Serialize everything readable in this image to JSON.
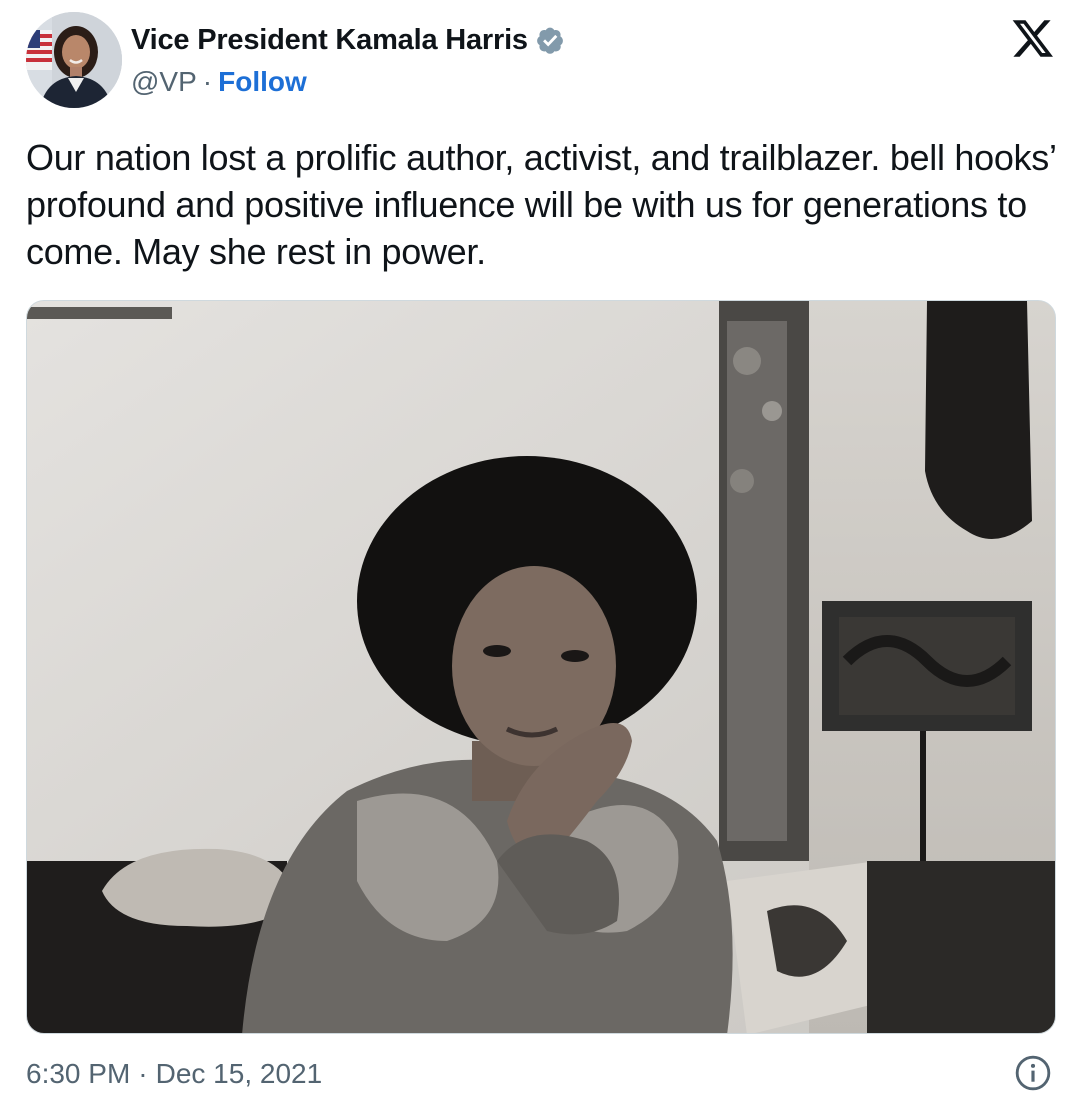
{
  "author": {
    "display_name": "Vice President Kamala Harris",
    "handle": "@VP",
    "separator": "·",
    "follow_label": "Follow",
    "verified_icon": "verified-badge-icon",
    "avatar_alt": "Kamala Harris profile photo"
  },
  "tweet": {
    "text": "Our nation lost a prolific author, activist, and trailblazer. bell hooks’ profound and positive influence will be with us for generations to come. May she rest in power.",
    "media_alt": "Black and white photograph of bell hooks"
  },
  "meta": {
    "time": "6:30 PM",
    "separator": "·",
    "date": "Dec 15, 2021"
  },
  "icons": {
    "platform_logo": "x-logo-icon",
    "info": "info-icon"
  },
  "colors": {
    "text": "#0f1419",
    "secondary": "#536471",
    "link": "#1d6fd6",
    "verified_badge": "#829aab"
  }
}
